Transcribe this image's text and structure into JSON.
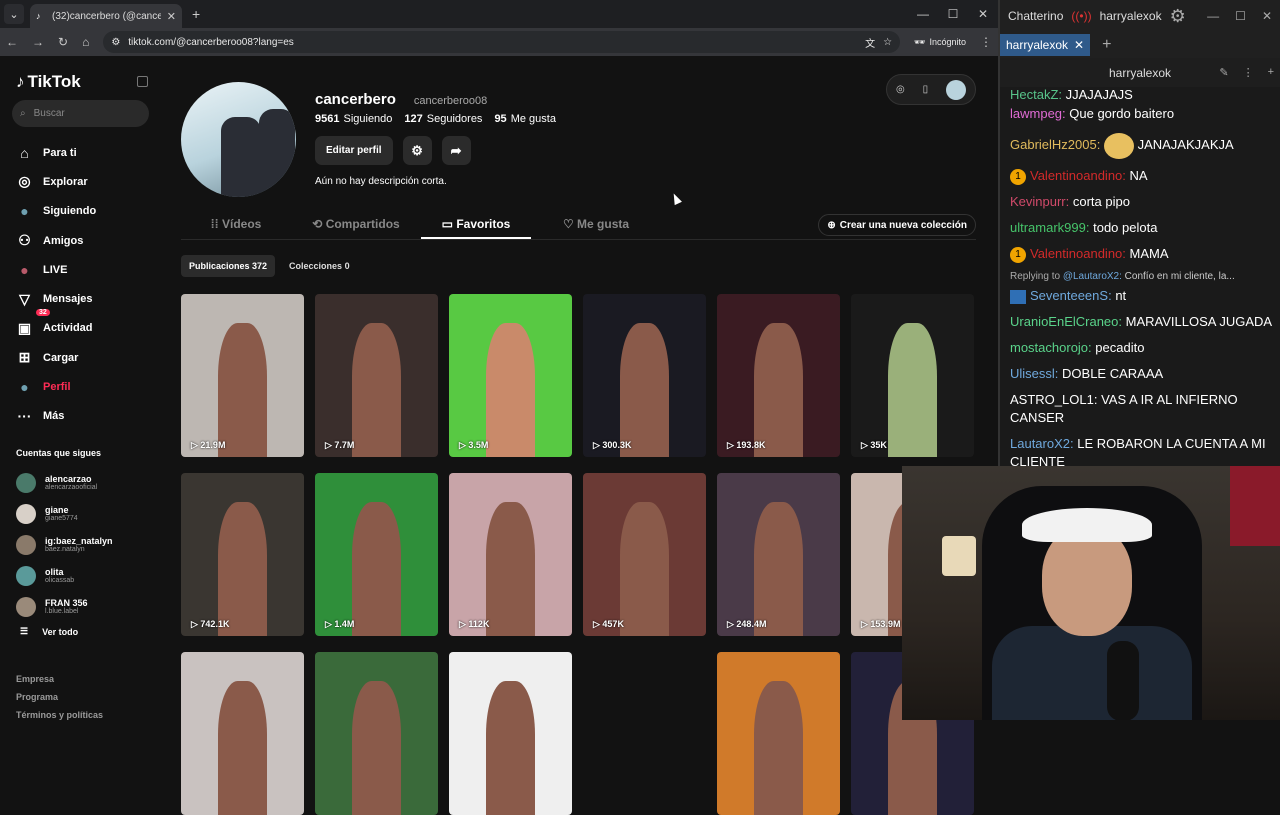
{
  "browser": {
    "tab_title": "(32)cancerbero (@cancerbero0",
    "url": "tiktok.com/@cancerberoo08?lang=es",
    "incognito_label": "Incógnito"
  },
  "tiktok": {
    "logo": "TikTok",
    "search_placeholder": "Buscar",
    "nav": [
      {
        "label": "Para ti",
        "icon": "home-icon"
      },
      {
        "label": "Explorar",
        "icon": "compass-icon"
      },
      {
        "label": "Siguiendo",
        "icon": "avatar-icon"
      },
      {
        "label": "Amigos",
        "icon": "friends-icon"
      },
      {
        "label": "LIVE",
        "icon": "live-icon"
      },
      {
        "label": "Mensajes",
        "icon": "message-icon"
      },
      {
        "label": "Actividad",
        "icon": "inbox-icon",
        "badge": "32"
      },
      {
        "label": "Cargar",
        "icon": "upload-icon"
      },
      {
        "label": "Perfil",
        "icon": "profile-icon"
      },
      {
        "label": "Más",
        "icon": "more-icon"
      }
    ],
    "following_title": "Cuentas que sigues",
    "following": [
      {
        "name": "alencarzao",
        "user": "alencarzaooficial"
      },
      {
        "name": "giane",
        "user": "giane5774"
      },
      {
        "name": "ig:baez_natalyn",
        "user": "baez.natalyn"
      },
      {
        "name": "olita",
        "user": "olicassab"
      },
      {
        "name": "FRAN 356",
        "user": "l.blue.label"
      }
    ],
    "see_all": "Ver todo",
    "footer": [
      "Empresa",
      "Programa",
      "Términos y políticas"
    ],
    "profile": {
      "name": "cancerbero",
      "handle": "cancerberoo08",
      "following_count": "9561",
      "following_label": "Siguiendo",
      "followers_count": "127",
      "followers_label": "Seguidores",
      "likes_count": "95",
      "likes_label": "Me gusta",
      "edit_button": "Editar perfil",
      "bio": "Aún no hay descripción corta."
    },
    "tabs": [
      "Vídeos",
      "Compartidos",
      "Favoritos",
      "Me gusta"
    ],
    "new_collection": "Crear una nueva colección",
    "segments": [
      "Publicaciones 372",
      "Colecciones 0"
    ],
    "videos": [
      "21.9M",
      "7.7M",
      "3.5M",
      "300.3K",
      "193.8K",
      "35K",
      "742.1K",
      "1.4M",
      "112K",
      "457K",
      "248.4M",
      "153.9M",
      "",
      "",
      "",
      "",
      "",
      ""
    ],
    "thumb_colors": [
      "#bdb7b2",
      "#3a2e2c",
      "#58c943",
      "#1a1a22",
      "#3a1b22",
      "#1a1a1a",
      "#3a3631",
      "#2f8f3a",
      "#c8a4a8",
      "#6b3a35",
      "#4a3a48",
      "#c9b7ae",
      "#c9c2c0",
      "#3a6a3a",
      "#efefef",
      "#121212",
      "#d07a2a",
      "#222038"
    ]
  },
  "chat": {
    "app": "Chatterino",
    "channel": "harryalexok",
    "tab": "harryalexok",
    "header": "harryalexok",
    "messages": [
      {
        "user": "HectakZ:",
        "text": "JJAJAJAJS",
        "color": "#58c48a"
      },
      {
        "user": "lawmpeg:",
        "text": "Que gordo baitero",
        "color": "#e06bd4"
      },
      {
        "user": "GabrielHz2005:",
        "text": "JANAJAKJAKJA",
        "color": "#e0ba5c",
        "emote": true
      },
      {
        "user": "Valentinoandino:",
        "text": "NA",
        "color": "#d22a2a",
        "sub": "1"
      },
      {
        "user": "Kevinpurr:",
        "text": "corta pipo",
        "color": "#d14a6a"
      },
      {
        "user": "ultramark999:",
        "text": "todo pelota",
        "color": "#46c46a"
      },
      {
        "user": "Valentinoandino:",
        "text": "MAMA",
        "color": "#d22a2a",
        "sub": "1"
      },
      {
        "user": "SeventeeenS:",
        "text": "nt",
        "color": "#6fa8dc",
        "reply_to": "@LautaroX2:",
        "reply_text": "Confío en mi cliente, la..."
      },
      {
        "user": "UranioEnElCraneo:",
        "text": "MARAVILLOSA JUGADA",
        "color": "#5ad38a"
      },
      {
        "user": "mostachorojo:",
        "text": "pecadito",
        "color": "#5ad38a"
      },
      {
        "user": "Ulisessl:",
        "text": "DOBLE CARAAA",
        "color": "#6fa8dc"
      },
      {
        "user": "ASTRO_LOL1:",
        "text": "VAS A IR AL INFIERNO CANSER",
        "color": "#ffffff"
      },
      {
        "user": "LautaroX2:",
        "text": "LE ROBARON LA CUENTA A MI CLIENTE",
        "color": "#6fa8dc"
      }
    ],
    "reply_prefix": "Replying to"
  }
}
